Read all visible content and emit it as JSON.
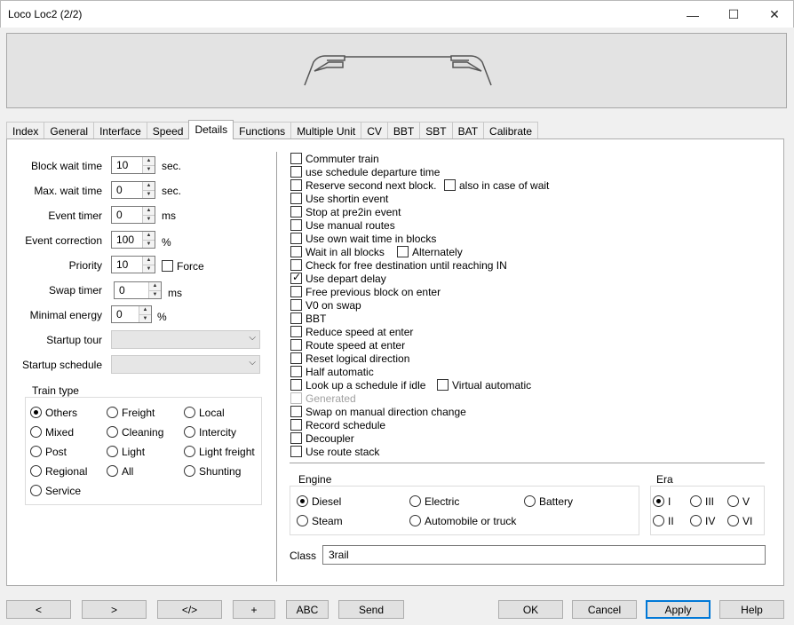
{
  "window": {
    "title": "Loco Loc2 (2/2)",
    "minimize_glyph": "—",
    "maximize_glyph": "☐",
    "close_glyph": "✕"
  },
  "tabs": [
    "Index",
    "General",
    "Interface",
    "Speed",
    "Details",
    "Functions",
    "Multiple Unit",
    "CV",
    "BBT",
    "SBT",
    "BAT",
    "Calibrate"
  ],
  "active_tab": "Details",
  "fields": {
    "block_wait_time": {
      "label": "Block wait time",
      "value": "10",
      "unit": "sec."
    },
    "max_wait_time": {
      "label": "Max. wait time",
      "value": "0",
      "unit": "sec."
    },
    "event_timer": {
      "label": "Event timer",
      "value": "0",
      "unit": "ms"
    },
    "event_correction": {
      "label": "Event correction",
      "value": "100",
      "unit": "%"
    },
    "priority": {
      "label": "Priority",
      "value": "10",
      "force_label": "Force",
      "force_checked": false
    },
    "swap_timer": {
      "label": "Swap timer",
      "value": "0",
      "unit": "ms"
    },
    "minimal_energy": {
      "label": "Minimal energy",
      "value": "0",
      "unit": "%"
    },
    "startup_tour": {
      "label": "Startup tour",
      "value": ""
    },
    "startup_schedule": {
      "label": "Startup schedule",
      "value": ""
    }
  },
  "train_type": {
    "title": "Train type",
    "options": [
      "Others",
      "Freight",
      "Local",
      "Mixed",
      "Cleaning",
      "Intercity",
      "Post",
      "Light",
      "Light freight",
      "Regional",
      "All",
      "Shunting",
      "Service"
    ],
    "selected": "Others"
  },
  "options": [
    {
      "label": "Commuter train",
      "checked": false
    },
    {
      "label": "use schedule departure time",
      "checked": false
    },
    {
      "label": "Reserve second next block.",
      "checked": false,
      "extra": {
        "label": "also in case of wait",
        "checked": false
      }
    },
    {
      "label": "Use shortin event",
      "checked": false
    },
    {
      "label": "Stop at pre2in event",
      "checked": false
    },
    {
      "label": "Use manual routes",
      "checked": false
    },
    {
      "label": "Use own wait time in blocks",
      "checked": false
    },
    {
      "label": "Wait in all blocks",
      "checked": false,
      "extra": {
        "label": "Alternately",
        "checked": false
      }
    },
    {
      "label": "Check for free destination until reaching IN",
      "checked": false
    },
    {
      "label": "Use depart delay",
      "checked": true
    },
    {
      "label": "Free previous block on enter",
      "checked": false
    },
    {
      "label": "V0 on swap",
      "checked": false
    },
    {
      "label": "BBT",
      "checked": false
    },
    {
      "label": "Reduce speed at enter",
      "checked": false
    },
    {
      "label": "Route speed at enter",
      "checked": false
    },
    {
      "label": "Reset logical direction",
      "checked": false
    },
    {
      "label": "Half automatic",
      "checked": false
    },
    {
      "label": "Look up a schedule if idle",
      "checked": false,
      "extra": {
        "label": "Virtual automatic",
        "checked": false
      }
    },
    {
      "label": "Generated",
      "checked": false,
      "disabled": true
    },
    {
      "label": "Swap on manual direction change",
      "checked": false
    },
    {
      "label": "Record schedule",
      "checked": false
    },
    {
      "label": "Decoupler",
      "checked": false
    },
    {
      "label": "Use route stack",
      "checked": false
    }
  ],
  "engine": {
    "title": "Engine",
    "options": [
      "Diesel",
      "Electric",
      "Battery",
      "Steam",
      "Automobile or truck"
    ],
    "selected": "Diesel"
  },
  "era": {
    "title": "Era",
    "options": [
      "I",
      "III",
      "V",
      "II",
      "IV",
      "VI"
    ],
    "selected": "I"
  },
  "class": {
    "label": "Class",
    "value": "3rail"
  },
  "buttons": {
    "prev": "<",
    "next": ">",
    "code": "</>",
    "add": "+",
    "abc": "ABC",
    "send": "Send",
    "ok": "OK",
    "cancel": "Cancel",
    "apply": "Apply",
    "help": "Help"
  },
  "colors": {
    "accent": "#0078d7",
    "panel": "#ffffff",
    "background": "#f0f0f0"
  }
}
